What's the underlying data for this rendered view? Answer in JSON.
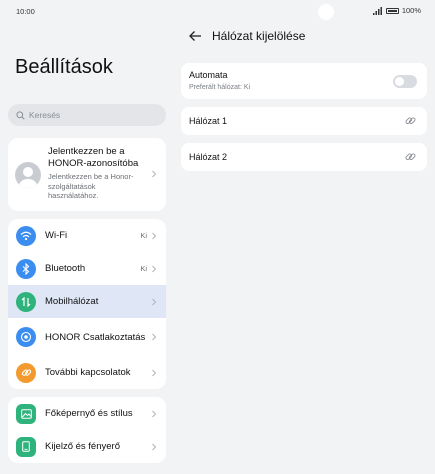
{
  "status": {
    "time": "10:00",
    "battery": "100%"
  },
  "left": {
    "title": "Beállítások",
    "search_placeholder": "Keresés",
    "account": {
      "title": "Jelentkezzen be a HONOR-azonosítóba",
      "subtitle": "Jelentkezzen be a Honor-szolgáltatások használatához."
    },
    "group1": [
      {
        "label": "Wi-Fi",
        "value": "Ki",
        "icon": "wifi-icon",
        "color": "#3b8df0"
      },
      {
        "label": "Bluetooth",
        "value": "Ki",
        "icon": "bluetooth-icon",
        "color": "#3b8df0"
      },
      {
        "label": "Mobilhálózat",
        "value": "",
        "icon": "mobile-data-icon",
        "color": "#2fb37c",
        "selected": true
      },
      {
        "label": "HONOR Csatlakoztatás",
        "value": "",
        "icon": "honor-connect-icon",
        "color": "#3b8df0"
      },
      {
        "label": "További kapcsolatok",
        "value": "",
        "icon": "link-icon",
        "color": "#f29a2e"
      }
    ],
    "group2": [
      {
        "label": "Főképernyő és stílus",
        "icon": "wallpaper-icon",
        "color": "#2fb37c"
      },
      {
        "label": "Kijelző és fényerő",
        "icon": "display-icon",
        "color": "#2fb37c"
      }
    ]
  },
  "right": {
    "title": "Hálózat kijelölése",
    "auto": {
      "label": "Automata",
      "sub": "Preferált hálózat: Ki",
      "enabled": false
    },
    "networks": [
      "Hálózat 1",
      "Hálózat 2"
    ]
  }
}
